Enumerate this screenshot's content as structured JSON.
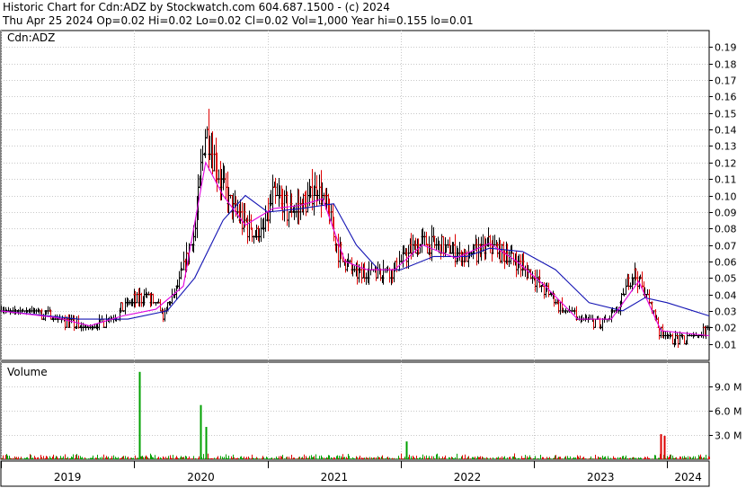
{
  "header": {
    "line1": "Historic Chart for Cdn:ADZ by Stockwatch.com 604.687.1500 - (c) 2024",
    "line2": "Thu Apr 25 2024  Op=0.02  Hi=0.02  Lo=0.02  Cl=0.02  Vol=1,000  Year hi=0.155  lo=0.01"
  },
  "chart_data": [
    {
      "type": "line",
      "name": "price-panel",
      "symbol_label": "Cdn:ADZ",
      "bar_style": "OHLC, black bars, red when closing lower",
      "ylim": [
        0.0,
        0.2
      ],
      "y_ticks": [
        "0.01",
        "0.02",
        "0.03",
        "0.04",
        "0.05",
        "0.06",
        "0.07",
        "0.08",
        "0.09",
        "0.10",
        "0.11",
        "0.12",
        "0.13",
        "0.14",
        "0.15",
        "0.16",
        "0.17",
        "0.18",
        "0.19"
      ],
      "grid": true,
      "colors": {
        "price_bar": "#000000",
        "down_bar": "#dd0000",
        "short_ma": "#e000e0",
        "long_ma": "#1414b4"
      },
      "price_points": [
        [
          "2019-01-01",
          0.03
        ],
        [
          "2019-03-15",
          0.03
        ],
        [
          "2019-06-01",
          0.026
        ],
        [
          "2019-08-15",
          0.02
        ],
        [
          "2019-11-01",
          0.025
        ],
        [
          "2019-12-15",
          0.035
        ],
        [
          "2020-02-01",
          0.04
        ],
        [
          "2020-03-20",
          0.028
        ],
        [
          "2020-05-01",
          0.045
        ],
        [
          "2020-06-15",
          0.08
        ],
        [
          "2020-07-15",
          0.14
        ],
        [
          "2020-08-15",
          0.115
        ],
        [
          "2020-10-01",
          0.09
        ],
        [
          "2020-11-15",
          0.08
        ],
        [
          "2020-12-15",
          0.075
        ],
        [
          "2021-01-15",
          0.1
        ],
        [
          "2021-03-01",
          0.09
        ],
        [
          "2021-04-15",
          0.095
        ],
        [
          "2021-05-15",
          0.105
        ],
        [
          "2021-06-15",
          0.09
        ],
        [
          "2021-07-15",
          0.065
        ],
        [
          "2021-09-01",
          0.052
        ],
        [
          "2021-11-01",
          0.055
        ],
        [
          "2021-12-15",
          0.055
        ],
        [
          "2022-01-15",
          0.065
        ],
        [
          "2022-03-01",
          0.072
        ],
        [
          "2022-05-01",
          0.068
        ],
        [
          "2022-07-01",
          0.062
        ],
        [
          "2022-09-01",
          0.07
        ],
        [
          "2022-11-01",
          0.062
        ],
        [
          "2023-01-01",
          0.05
        ],
        [
          "2023-03-01",
          0.035
        ],
        [
          "2023-05-01",
          0.025
        ],
        [
          "2023-07-01",
          0.022
        ],
        [
          "2023-08-15",
          0.03
        ],
        [
          "2023-10-01",
          0.055
        ],
        [
          "2023-11-15",
          0.035
        ],
        [
          "2023-12-15",
          0.015
        ],
        [
          "2024-02-15",
          0.012
        ],
        [
          "2024-04-25",
          0.02
        ]
      ],
      "short_ma_points": [
        [
          "2019-01-01",
          0.03
        ],
        [
          "2019-06-01",
          0.026
        ],
        [
          "2019-09-01",
          0.021
        ],
        [
          "2019-12-01",
          0.027
        ],
        [
          "2020-03-01",
          0.031
        ],
        [
          "2020-05-15",
          0.045
        ],
        [
          "2020-07-15",
          0.12
        ],
        [
          "2020-09-01",
          0.1
        ],
        [
          "2020-11-01",
          0.082
        ],
        [
          "2021-01-15",
          0.092
        ],
        [
          "2021-04-01",
          0.094
        ],
        [
          "2021-06-01",
          0.098
        ],
        [
          "2021-08-01",
          0.06
        ],
        [
          "2021-10-01",
          0.055
        ],
        [
          "2021-12-15",
          0.055
        ],
        [
          "2022-03-01",
          0.07
        ],
        [
          "2022-06-01",
          0.062
        ],
        [
          "2022-09-01",
          0.071
        ],
        [
          "2022-11-15",
          0.06
        ],
        [
          "2023-02-01",
          0.045
        ],
        [
          "2023-05-01",
          0.025
        ],
        [
          "2023-08-01",
          0.025
        ],
        [
          "2023-10-15",
          0.048
        ],
        [
          "2023-12-15",
          0.018
        ],
        [
          "2024-04-25",
          0.015
        ]
      ],
      "long_ma_points": [
        [
          "2019-01-01",
          0.03
        ],
        [
          "2019-08-01",
          0.025
        ],
        [
          "2019-12-15",
          0.025
        ],
        [
          "2020-04-01",
          0.03
        ],
        [
          "2020-06-15",
          0.05
        ],
        [
          "2020-09-01",
          0.085
        ],
        [
          "2020-11-01",
          0.1
        ],
        [
          "2021-01-01",
          0.09
        ],
        [
          "2021-04-01",
          0.092
        ],
        [
          "2021-07-01",
          0.095
        ],
        [
          "2021-09-01",
          0.07
        ],
        [
          "2021-11-01",
          0.055
        ],
        [
          "2022-01-01",
          0.055
        ],
        [
          "2022-04-01",
          0.063
        ],
        [
          "2022-07-01",
          0.063
        ],
        [
          "2022-09-01",
          0.068
        ],
        [
          "2022-12-01",
          0.066
        ],
        [
          "2023-03-01",
          0.055
        ],
        [
          "2023-06-01",
          0.035
        ],
        [
          "2023-09-01",
          0.03
        ],
        [
          "2023-11-01",
          0.038
        ],
        [
          "2024-01-01",
          0.035
        ],
        [
          "2024-04-25",
          0.027
        ]
      ]
    },
    {
      "type": "bar",
      "name": "volume-panel",
      "title": "Volume",
      "ylim": [
        0,
        12000000
      ],
      "y_ticks": [
        "3.0 M",
        "6.0 M",
        "9.0 M"
      ],
      "bar_colors": {
        "up": "#00a000",
        "down": "#dd0000"
      },
      "spikes": [
        [
          "2020-01-15",
          10800000,
          "up"
        ],
        [
          "2020-07-01",
          6700000,
          "up"
        ],
        [
          "2020-07-15",
          4000000,
          "up"
        ],
        [
          "2022-01-15",
          2200000,
          "up"
        ],
        [
          "2023-12-15",
          3100000,
          "down"
        ],
        [
          "2023-12-25",
          2900000,
          "down"
        ]
      ]
    }
  ],
  "x_axis": {
    "year_labels": [
      "2019",
      "2020",
      "2021",
      "2022",
      "2023",
      "2024"
    ],
    "start": "2019-01-01",
    "end": "2024-04-25"
  }
}
